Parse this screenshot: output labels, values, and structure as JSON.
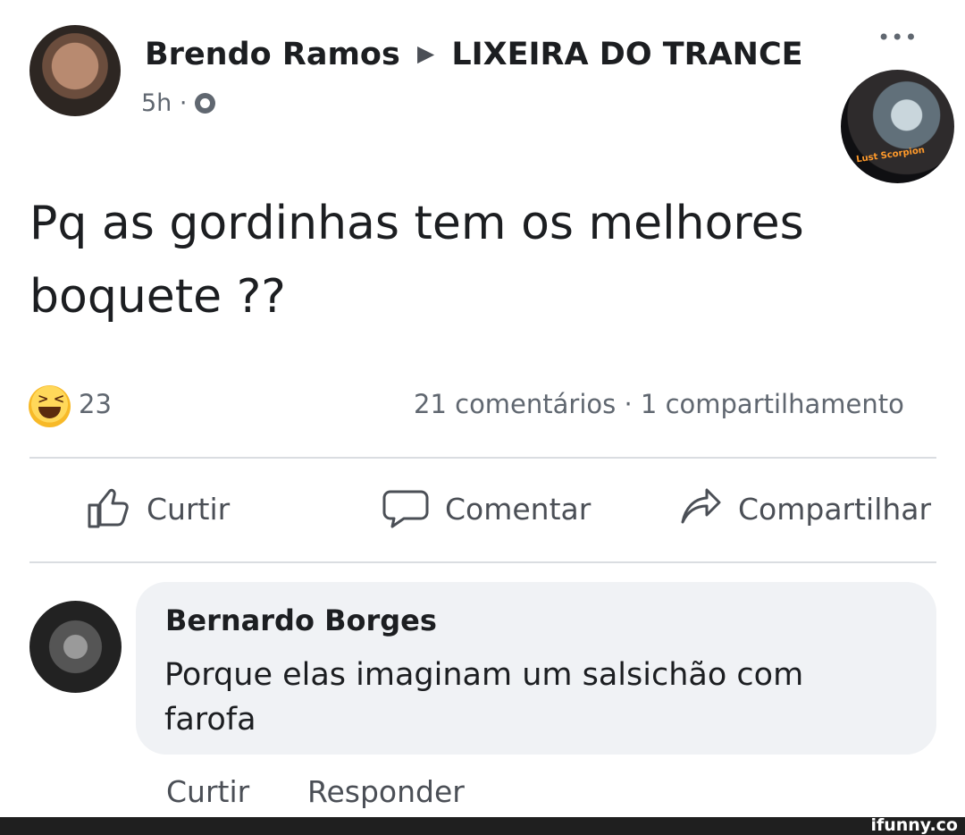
{
  "post": {
    "poster_name": "Brendo Ramos",
    "group_name": "LIXEIRA DO TRANCE",
    "time": "5h",
    "separator": "·",
    "text": "Pq as gordinhas tem os melhores boquete ??",
    "group_avatar_text": "Lust Scorpion",
    "more_icon": "more-horizontal-icon"
  },
  "reactions": {
    "icon": "haha-emoji-icon",
    "count": "23",
    "stats": "21 comentários · 1 compartilhamento"
  },
  "actions": {
    "like": "Curtir",
    "comment": "Comentar",
    "share": "Compartilhar"
  },
  "comment": {
    "author": "Bernardo Borges",
    "text": "Porque elas imaginam um salsichão com farofa",
    "like": "Curtir",
    "reply": "Responder"
  },
  "footer": {
    "watermark": "ifunny.co"
  }
}
